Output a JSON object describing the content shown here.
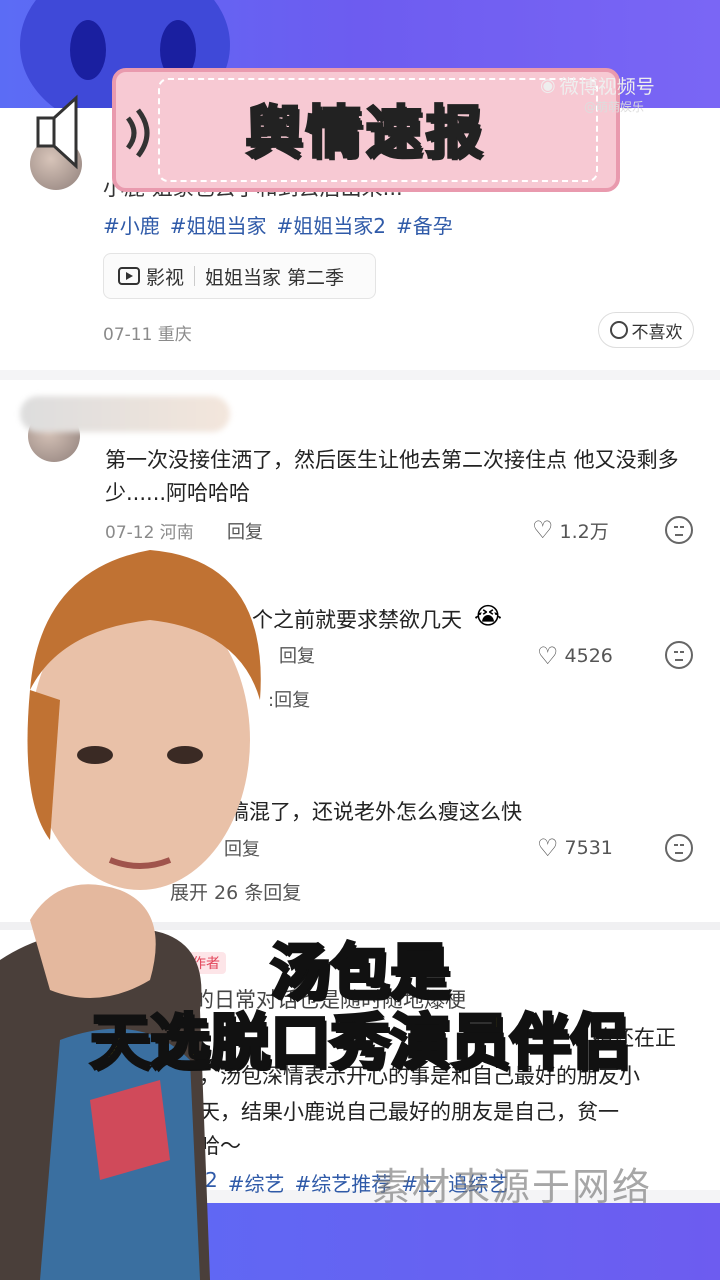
{
  "banner": {
    "title": "舆情速报"
  },
  "weibo": {
    "label": "微博视频号",
    "sub": "@萌萌娱乐"
  },
  "post": {
    "text_partial": "小鹿 姐家也去了和到去后出来...",
    "tags": [
      "#小鹿",
      "#姐姐当家",
      "#姐姐当家2",
      "#备孕"
    ],
    "chip_category": "影视",
    "chip_title": "姐姐当家 第二季",
    "date_location": "07-11 重庆",
    "dislike_label": "不喜欢"
  },
  "comments": [
    {
      "text": "第一次没接住洒了，然后医生让他去第二次接住点 他又没剩多少......阿哈哈哈",
      "date_location": "07-12 河南",
      "reply_label": "回复",
      "likes": "1.2万"
    },
    {
      "text": "个之前就要求禁欲几天",
      "reply_label": "回复",
      "likes": "4526",
      "sub_reply": ":回复"
    },
    {
      "text": "搞混了，还说老外怎么瘦这么快",
      "reply_label": "回复",
      "likes": "7531",
      "expand_label": "展开 26 条回复"
    }
  ],
  "author_post": {
    "badge": "作者",
    "line1": "公的日常对话也是随时随地爆梗",
    "line2": "始还在正",
    "line3": "天，汤包深情表示开心的事是和自己最好的朋友小",
    "line4": "一天，结果小鹿说自己最好的朋友是自己，贫一",
    "line5": "哈哈～",
    "tags": [
      "2",
      "#综艺",
      "#综艺推荐",
      "#上",
      "追综艺"
    ]
  },
  "overlay": {
    "line1": "汤包是",
    "line2": "天选脱口秀演员伴侣"
  },
  "watermark": "素材来源于网络",
  "colors": {
    "accent_purple": "#6a63f0",
    "banner_pink": "#f7c9d3",
    "caption_yellow": "#ffe400",
    "tag_blue": "#2f5aa8"
  }
}
